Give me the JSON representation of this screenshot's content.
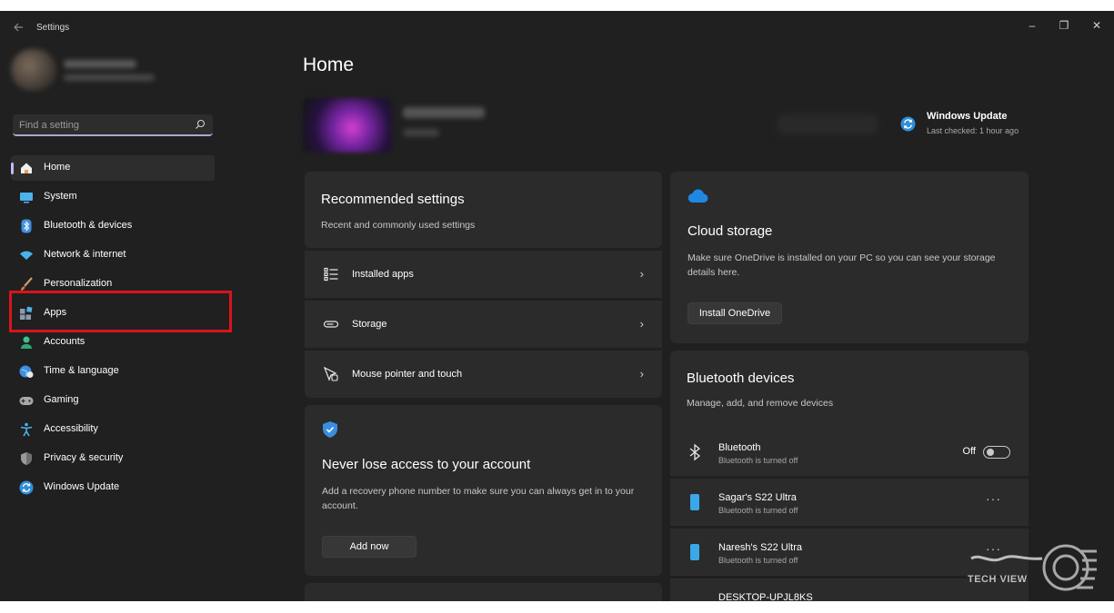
{
  "window": {
    "title": "Settings",
    "controls": {
      "minimize": "–",
      "restore": "❐",
      "close": "✕"
    }
  },
  "sidebar": {
    "search_placeholder": "Find a setting",
    "items": [
      {
        "label": "Home",
        "icon": "home-icon",
        "active": true
      },
      {
        "label": "System",
        "icon": "system-icon"
      },
      {
        "label": "Bluetooth & devices",
        "icon": "bluetooth-icon"
      },
      {
        "label": "Network & internet",
        "icon": "wifi-icon"
      },
      {
        "label": "Personalization",
        "icon": "brush-icon"
      },
      {
        "label": "Apps",
        "icon": "apps-icon"
      },
      {
        "label": "Accounts",
        "icon": "person-icon"
      },
      {
        "label": "Time & language",
        "icon": "globe-clock-icon"
      },
      {
        "label": "Gaming",
        "icon": "gamepad-icon"
      },
      {
        "label": "Accessibility",
        "icon": "accessibility-icon"
      },
      {
        "label": "Privacy & security",
        "icon": "shield-icon"
      },
      {
        "label": "Windows Update",
        "icon": "update-icon"
      }
    ]
  },
  "main": {
    "title": "Home",
    "windows_update": {
      "title": "Windows Update",
      "status": "Last checked: 1 hour ago"
    },
    "recommended": {
      "title": "Recommended settings",
      "subtitle": "Recent and commonly used settings",
      "rows": [
        {
          "label": "Installed apps",
          "icon": "list-icon"
        },
        {
          "label": "Storage",
          "icon": "storage-icon"
        },
        {
          "label": "Mouse pointer and touch",
          "icon": "pointer-icon"
        }
      ]
    },
    "account_card": {
      "title": "Never lose access to your account",
      "description": "Add a recovery phone number to make sure you can always get in to your account.",
      "button": "Add now"
    },
    "cloud": {
      "title": "Cloud storage",
      "description": "Make sure OneDrive is installed on your PC so you can see your storage details here.",
      "button": "Install OneDrive"
    },
    "bluetooth": {
      "title": "Bluetooth devices",
      "subtitle": "Manage, add, and remove devices",
      "toggle": {
        "name": "Bluetooth",
        "status": "Bluetooth is turned off",
        "state": "Off"
      },
      "devices": [
        {
          "name": "Sagar's S22 Ultra",
          "status": "Bluetooth is turned off"
        },
        {
          "name": "Naresh's S22 Ultra",
          "status": "Bluetooth is turned off"
        },
        {
          "name": "DESKTOP-UPJL8KS",
          "status": ""
        }
      ],
      "more": "···"
    }
  },
  "watermark": {
    "text": "TECH VIEW"
  }
}
